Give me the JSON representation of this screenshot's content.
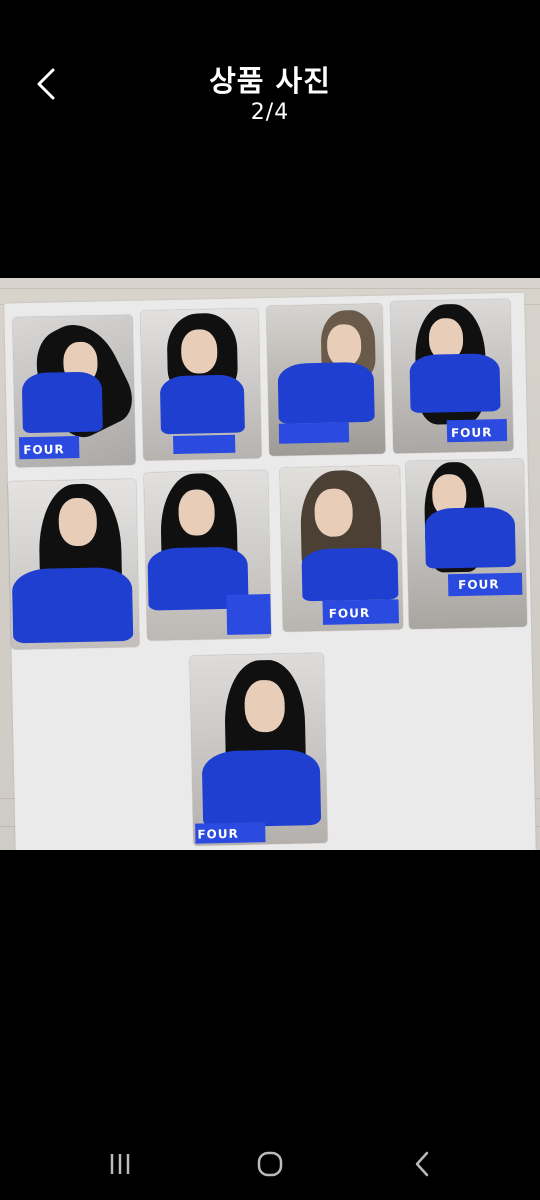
{
  "header": {
    "title": "상품 사진",
    "counter": "2/4"
  },
  "photo": {
    "description_icon": "photocard-set-image"
  },
  "navigation": {
    "recents": "recents-icon",
    "home": "home-icon",
    "back": "back-icon"
  },
  "colors": {
    "background": "#000000",
    "accent_blue": "#1f3fd1"
  }
}
